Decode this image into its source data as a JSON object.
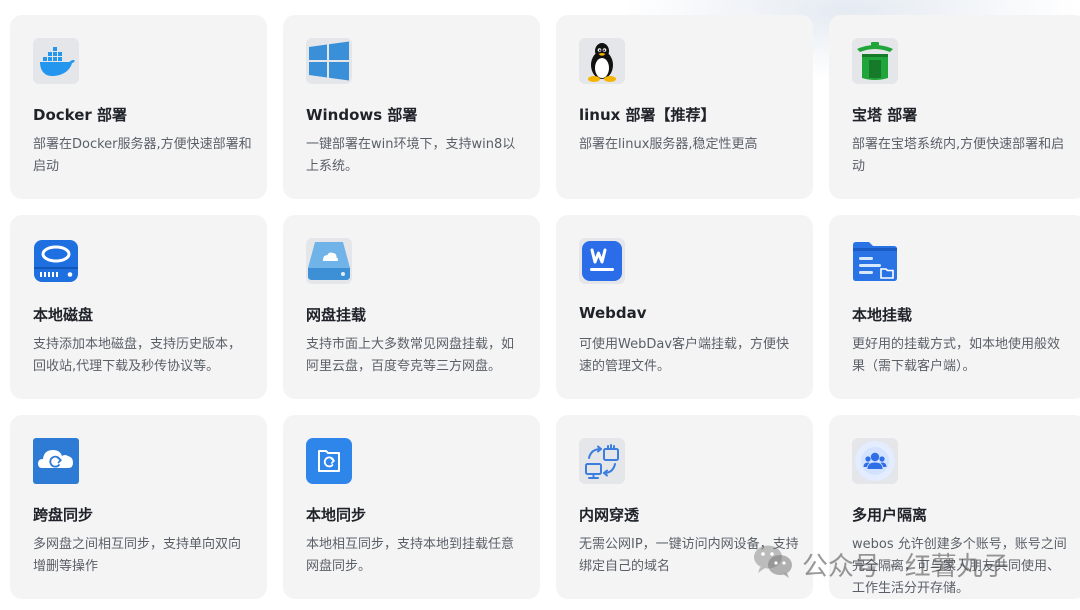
{
  "cards": [
    {
      "title": "Docker 部署",
      "desc": "部署在Docker服务器,方便快速部署和启动",
      "icon": "docker-icon"
    },
    {
      "title": "Windows 部署",
      "desc": "一键部署在win环境下，支持win8以上系统。",
      "icon": "windows-icon"
    },
    {
      "title": "linux 部署【推荐】",
      "desc": "部署在linux服务器,稳定性更高",
      "icon": "linux-tux-icon"
    },
    {
      "title": "宝塔 部署",
      "desc": "部署在宝塔系统内,方便快速部署和启动",
      "icon": "baota-pagoda-icon"
    },
    {
      "title": "本地磁盘",
      "desc": "支持添加本地磁盘，支持历史版本，回收站,代理下载及秒传协议等。",
      "icon": "hard-disk-icon"
    },
    {
      "title": "网盘挂载",
      "desc": "支持市面上大多数常见网盘挂载，如阿里云盘，百度夸克等三方网盘。",
      "icon": "cloud-disk-icon"
    },
    {
      "title": "Webdav",
      "desc": "可使用WebDav客户端挂载，方便快速的管理文件。",
      "icon": "webdav-icon"
    },
    {
      "title": "本地挂载",
      "desc": "更好用的挂载方式，如本地使用般效果（需下载客户端）。",
      "icon": "folder-icon"
    },
    {
      "title": "跨盘同步",
      "desc": "多网盘之间相互同步，支持单向双向增删等操作",
      "icon": "cloud-sync-icon"
    },
    {
      "title": "本地同步",
      "desc": "本地相互同步，支持本地到挂载任意网盘同步。",
      "icon": "folder-sync-icon"
    },
    {
      "title": "内网穿透",
      "desc": "无需公网IP，一键访问内网设备，支持绑定自己的域名",
      "icon": "network-tunnel-icon"
    },
    {
      "title": "多用户隔离",
      "desc": "webos 允许创建多个账号，账号之间完全隔离，可与家人朋友共同使用、工作生活分开存储。",
      "icon": "users-icon"
    }
  ],
  "watermark": {
    "text": "公众号 · 红薯丸子",
    "icon": "wechat-icon"
  }
}
